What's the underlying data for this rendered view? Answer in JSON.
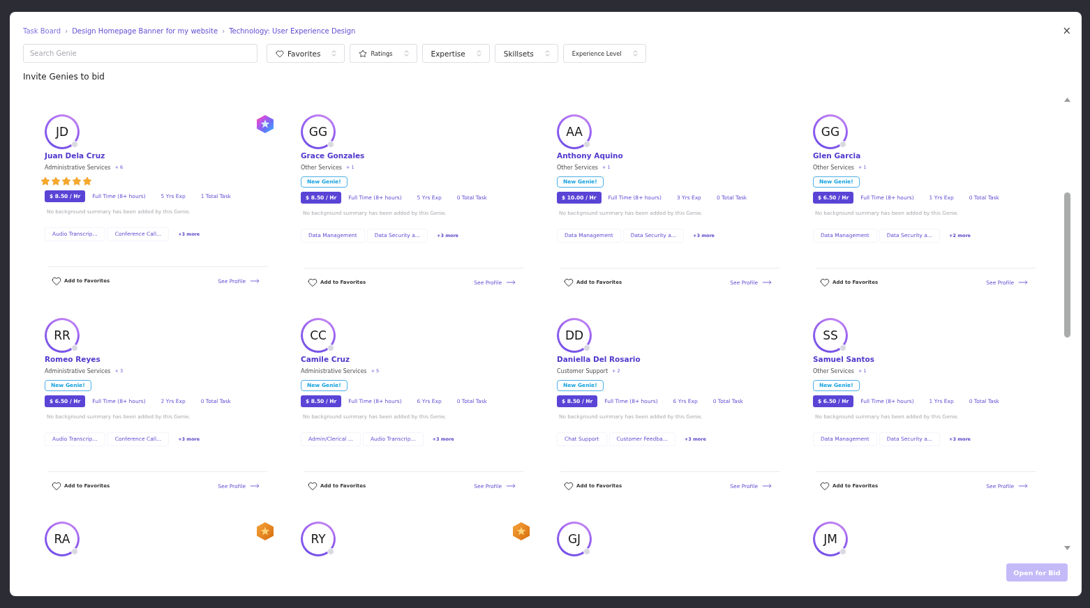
{
  "breadcrumb": {
    "separator": "›",
    "items": [
      "Task Board",
      "Design Homepage Banner for my website",
      "Technology: User Experience Design"
    ]
  },
  "close": "×",
  "search": {
    "placeholder": "Search Genie"
  },
  "filters": [
    {
      "label": "Favorites",
      "kind": "favorites"
    },
    {
      "label": "Ratings",
      "kind": "ratings"
    },
    {
      "label": "Expertise",
      "kind": "plain"
    },
    {
      "label": "Skillsets",
      "kind": "plain"
    },
    {
      "label": "Experience Level",
      "kind": "compact"
    }
  ],
  "heading": "Invite Genies to bid",
  "cards": [
    {
      "initials": "JD",
      "online": false,
      "badge": {
        "kind": "rainbow"
      },
      "name": "Juan Dela Cruz",
      "service": "Administrative Services",
      "service_extra": "+ 6",
      "stars": 5,
      "rate": "$ 8.50 / Hr",
      "schedule": "Full Time (8+ hours)",
      "experience": "5 Yrs Exp",
      "tasks": "1 Total Task",
      "summary": "No background summary has been added by this Genie.",
      "skills": [
        "Audio Transcrip...",
        "Conference Call..."
      ],
      "more": "+3 more",
      "favorite": {
        "label": "Add to Favorites",
        "favorited": false
      },
      "profile_link": "See Profile"
    },
    {
      "initials": "GG",
      "online": false,
      "name": "Grace Gonzales",
      "service": "Other Services",
      "service_extra": "+ 1",
      "tag": "New Genie!",
      "rate": "$ 8.50 / Hr",
      "schedule": "Full Time (8+ hours)",
      "experience": "5 Yrs Exp",
      "tasks": "0 Total Task",
      "summary": "No background summary has been added by this Genie.",
      "skills": [
        "Data Management",
        "Data Security a..."
      ],
      "more": "+3 more",
      "favorite": {
        "label": "Add to Favorites",
        "favorited": false
      },
      "profile_link": "See Profile"
    },
    {
      "initials": "AA",
      "online": false,
      "name": "Anthony Aquino",
      "service": "Other Services",
      "service_extra": "+ 1",
      "tag": "New Genie!",
      "rate": "$ 10.00 / Hr",
      "schedule": "Full Time (8+ hours)",
      "experience": "3 Yrs Exp",
      "tasks": "0 Total Task",
      "summary": "No background summary has been added by this Genie.",
      "skills": [
        "Data Management",
        "Data Security a..."
      ],
      "more": "+3 more",
      "favorite": {
        "label": "Add to Favorites",
        "favorited": false
      },
      "profile_link": "See Profile"
    },
    {
      "initials": "GG",
      "online": false,
      "name": "Glen Garcia",
      "service": "Other Services",
      "service_extra": "+ 1",
      "tag": "New Genie!",
      "rate": "$ 6.50 / Hr",
      "schedule": "Full Time (8+ hours)",
      "experience": "1 Yrs Exp",
      "tasks": "0 Total Task",
      "summary": "No background summary has been added by this Genie.",
      "skills": [
        "Data Management",
        "Data Security a..."
      ],
      "more": "+2 more",
      "favorite": {
        "label": "Add to Favorites",
        "favorited": false
      },
      "profile_link": "See Profile"
    },
    {
      "initials": "RR",
      "online": false,
      "name": "Romeo Reyes",
      "service": "Administrative Services",
      "service_extra": "+ 3",
      "tag": "New Genie!",
      "rate": "$ 6.50 / Hr",
      "schedule": "Full Time (8+ hours)",
      "experience": "2 Yrs Exp",
      "tasks": "0 Total Task",
      "summary": "No background summary has been added by this Genie.",
      "skills": [
        "Audio Transcrip...",
        "Conference Call..."
      ],
      "more": "+3 more",
      "favorite": {
        "label": "Add to Favorites",
        "favorited": false
      },
      "profile_link": "See Profile"
    },
    {
      "initials": "CC",
      "online": false,
      "name": "Camile Cruz",
      "service": "Administrative Services",
      "service_extra": "+ 5",
      "tag": "New Genie!",
      "rate": "$ 8.50 / Hr",
      "schedule": "Full Time (8+ hours)",
      "experience": "6 Yrs Exp",
      "tasks": "0 Total Task",
      "summary": "No background summary has been added by this Genie.",
      "skills": [
        "Admin/Clerical ...",
        "Audio Transcrip..."
      ],
      "more": "+3 more",
      "favorite": {
        "label": "Add to Favorites",
        "favorited": false
      },
      "profile_link": "See Profile"
    },
    {
      "initials": "DD",
      "online": false,
      "name": "Daniella Del Rosario",
      "service": "Customer Support",
      "service_extra": "+ 2",
      "tag": "New Genie!",
      "rate": "$ 8.50 / Hr",
      "schedule": "Full Time (8+ hours)",
      "experience": "6 Yrs Exp",
      "tasks": "0 Total Task",
      "summary": "No background summary has been added by this Genie.",
      "skills": [
        "Chat Support",
        "Customer Feedba..."
      ],
      "more": "+3 more",
      "favorite": {
        "label": "Add to Favorites",
        "favorited": false
      },
      "profile_link": "See Profile"
    },
    {
      "initials": "SS",
      "online": false,
      "name": "Samuel Santos",
      "service": "Other Services",
      "service_extra": "+ 1",
      "tag": "New Genie!",
      "rate": "$ 6.50 / Hr",
      "schedule": "Full Time (8+ hours)",
      "experience": "1 Yrs Exp",
      "tasks": "0 Total Task",
      "summary": "No background summary has been added by this Genie.",
      "skills": [
        "Data Management",
        "Data Security a..."
      ],
      "more": "+3 more",
      "favorite": {
        "label": "Add to Favorites",
        "favorited": false
      },
      "profile_link": "See Profile"
    },
    {
      "initials": "RA",
      "online": false,
      "badge": {
        "kind": "orange"
      }
    },
    {
      "initials": "RY",
      "online": false,
      "badge": {
        "kind": "orange"
      }
    },
    {
      "initials": "GJ",
      "online": false
    },
    {
      "initials": "JM",
      "online": false
    }
  ],
  "open_button": {
    "label": "Open for Bid",
    "disabled": true
  }
}
